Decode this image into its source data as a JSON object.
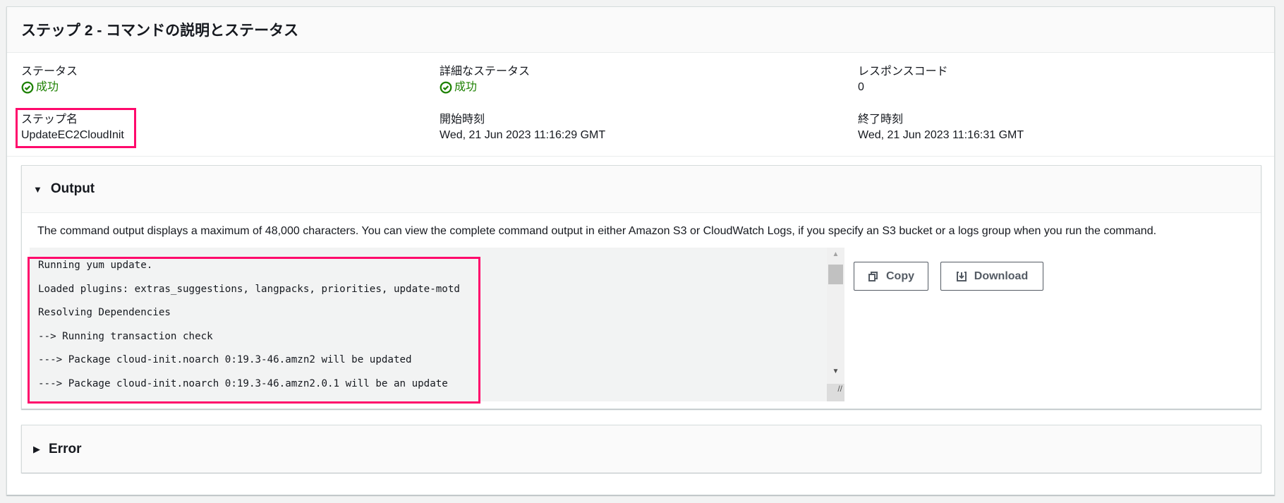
{
  "header": {
    "title": "ステップ 2 - コマンドの説明とステータス"
  },
  "details": {
    "status": {
      "label": "ステータス",
      "value": "成功"
    },
    "detailed_status": {
      "label": "詳細なステータス",
      "value": "成功"
    },
    "response_code": {
      "label": "レスポンスコード",
      "value": "0"
    },
    "step_name": {
      "label": "ステップ名",
      "value": "UpdateEC2CloudInit"
    },
    "start_time": {
      "label": "開始時刻",
      "value": "Wed, 21 Jun 2023 11:16:29 GMT"
    },
    "end_time": {
      "label": "終了時刻",
      "value": "Wed, 21 Jun 2023 11:16:31 GMT"
    }
  },
  "output": {
    "title": "Output",
    "description": "The command output displays a maximum of 48,000 characters. You can view the complete command output in either Amazon S3 or CloudWatch Logs, if you specify an S3 bucket or a logs group when you run the command.",
    "lines": [
      "Running yum update.",
      "Loaded plugins: extras_suggestions, langpacks, priorities, update-motd",
      "Resolving Dependencies",
      "--> Running transaction check",
      "---> Package cloud-init.noarch 0:19.3-46.amzn2 will be updated",
      "---> Package cloud-init.noarch 0:19.3-46.amzn2.0.1 will be an update"
    ],
    "copy_label": "Copy",
    "download_label": "Download"
  },
  "error": {
    "title": "Error"
  },
  "colors": {
    "success": "#1d8102",
    "highlight": "#ff0a6c"
  }
}
